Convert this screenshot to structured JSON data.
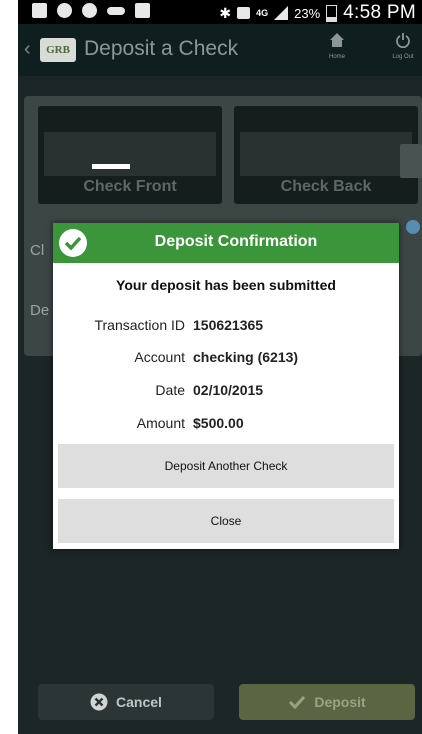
{
  "status_bar": {
    "battery": "23%",
    "time": "4:58 PM",
    "icons": [
      "plus-box-icon",
      "wifi-icon",
      "phone-icon",
      "voicemail-icon",
      "screenshot-icon",
      "bluetooth-icon",
      "mute-icon",
      "lte-icon",
      "signal-icon",
      "battery-icon"
    ]
  },
  "app_bar": {
    "logo_text": "GRB",
    "title": "Deposit a Check",
    "home_label": "Home",
    "logout_label": "Log Out"
  },
  "content": {
    "check_front_label": "Check Front",
    "check_back_label": "Check Back",
    "obscured_label_1": "Cl",
    "obscured_label_2": "De"
  },
  "dialog": {
    "title": "Deposit Confirmation",
    "message": "Your deposit has been submitted",
    "rows": [
      {
        "label": "Transaction ID",
        "value": "150621365"
      },
      {
        "label": "Account",
        "value": "checking (6213)"
      },
      {
        "label": "Date",
        "value": "02/10/2015"
      },
      {
        "label": "Amount",
        "value": "$500.00"
      }
    ],
    "deposit_another_label": "Deposit Another Check",
    "close_label": "Close"
  },
  "bottom_bar": {
    "cancel_label": "Cancel",
    "deposit_label": "Deposit"
  },
  "colors": {
    "header_green": "#3b963b",
    "background": "#1c2626",
    "button_gray": "#dedede"
  }
}
